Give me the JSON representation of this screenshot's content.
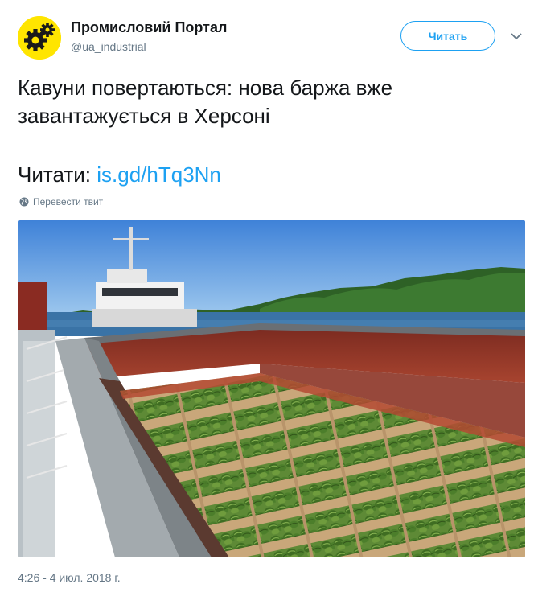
{
  "account": {
    "name": "Промисловий Портал",
    "handle": "@ua_industrial",
    "avatar_icon": "gear-logo-icon",
    "brand_color": "#ffe500"
  },
  "follow_button": {
    "label": "Читать"
  },
  "menu": {
    "icon": "chevron-down-icon"
  },
  "tweet": {
    "text": "Кавуни повертаються: нова баржа вже завантажується в Херсоні",
    "read_prefix": "Читати: ",
    "link_text": "is.gd/hTq3Nn"
  },
  "translate": {
    "label": "Перевести твит",
    "icon": "globe-icon"
  },
  "timestamp": "4:26 - 4 июл. 2018 г.",
  "colors": {
    "accent": "#1da1f2",
    "muted": "#657786",
    "text": "#14171a"
  }
}
